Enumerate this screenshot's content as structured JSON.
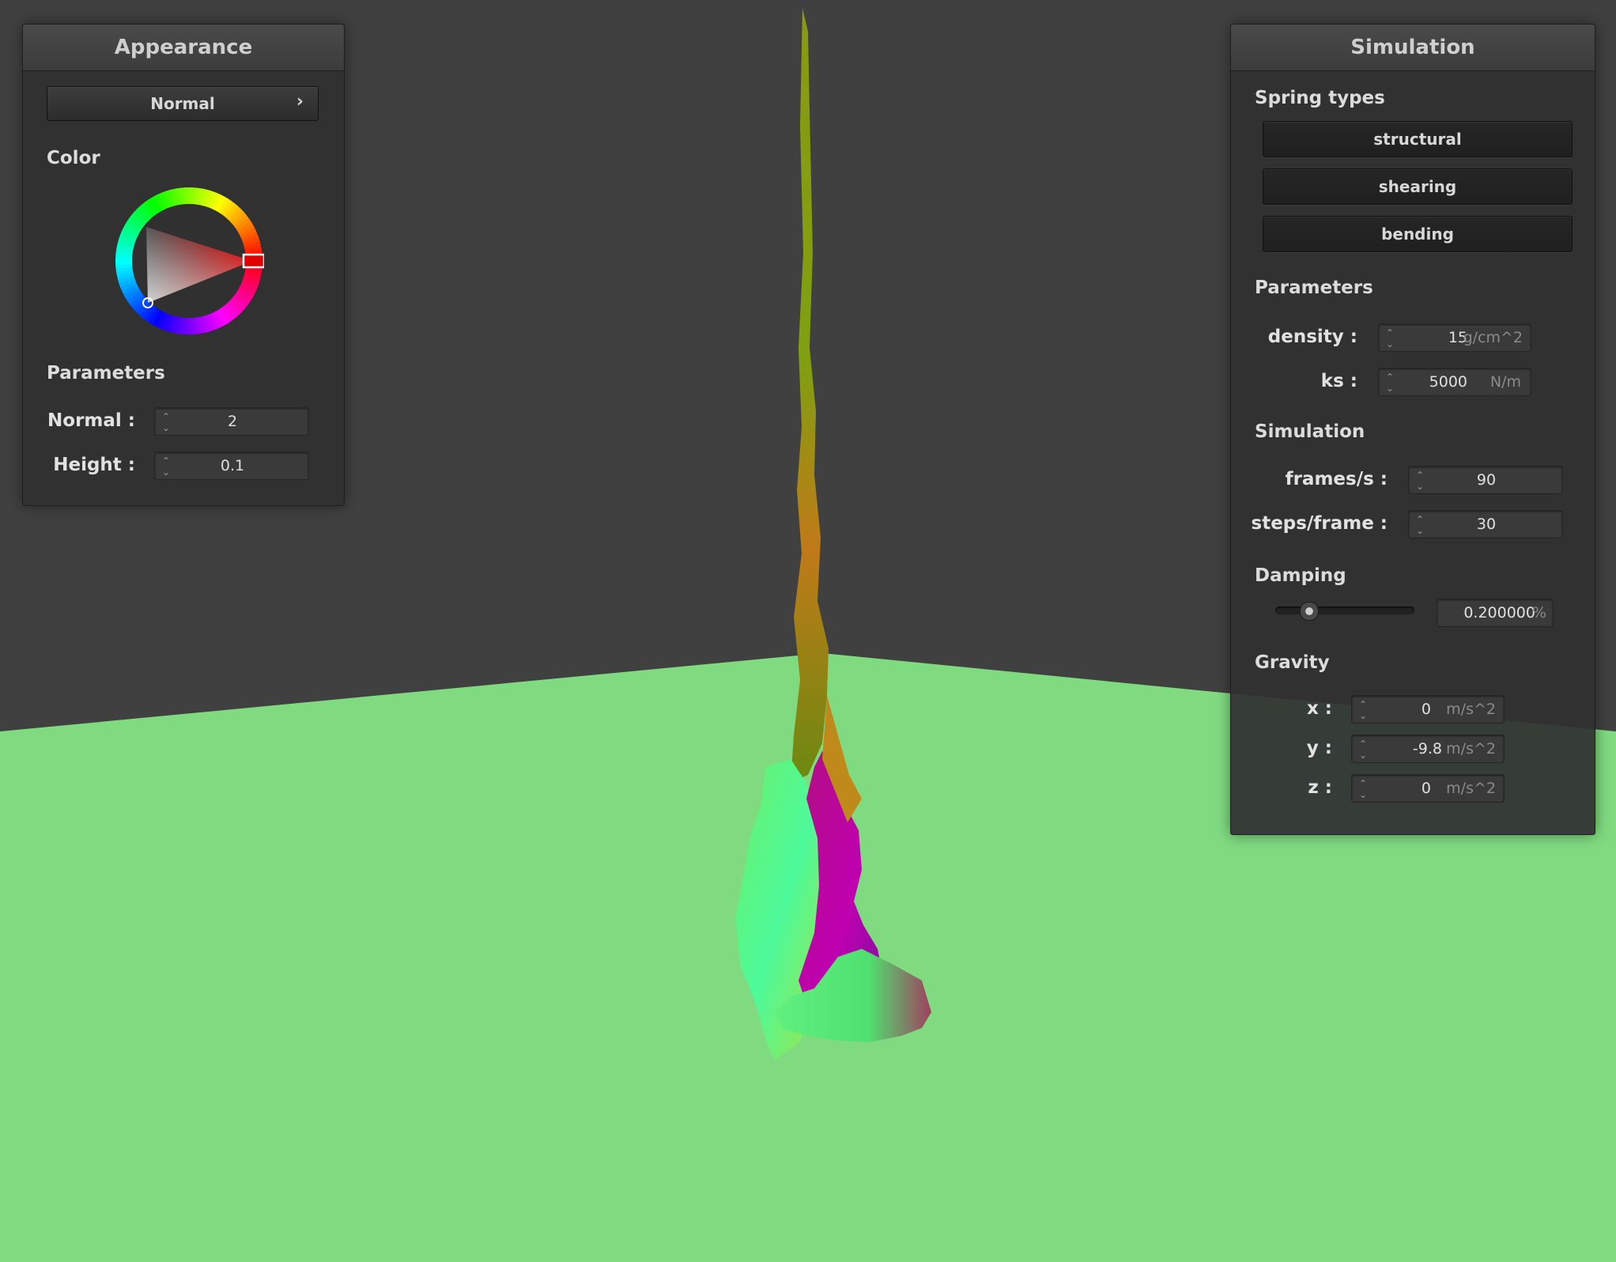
{
  "colors": {
    "background": "#404040",
    "floor": "#80db80",
    "panel": "#303030",
    "picked_color": "#e00000"
  },
  "appearance": {
    "title": "Appearance",
    "mode_button": "Normal",
    "mode_chevron": "›",
    "color_section": "Color",
    "parameters_section": "Parameters",
    "normal_label": "Normal :",
    "normal_value": "2",
    "height_label": "Height :",
    "height_value": "0.1"
  },
  "simulation": {
    "title": "Simulation",
    "spring_types_section": "Spring types",
    "spring_types": [
      "structural",
      "shearing",
      "bending"
    ],
    "parameters_section": "Parameters",
    "density_label": "density :",
    "density_value": "15",
    "density_unit": "g/cm^2",
    "ks_label": "ks :",
    "ks_value": "5000",
    "ks_unit": "N/m",
    "simulation_section": "Simulation",
    "fps_label": "frames/s :",
    "fps_value": "90",
    "spf_label": "steps/frame :",
    "spf_value": "30",
    "damping_section": "Damping",
    "damping_value": "0.200000",
    "damping_unit": "%",
    "damping_slider_fraction": 0.2,
    "gravity_section": "Gravity",
    "gx_label": "x :",
    "gx_value": "0",
    "gy_label": "y :",
    "gy_value": "-9.8",
    "gz_label": "z :",
    "gz_value": "0",
    "gravity_unit": "m/s^2"
  }
}
